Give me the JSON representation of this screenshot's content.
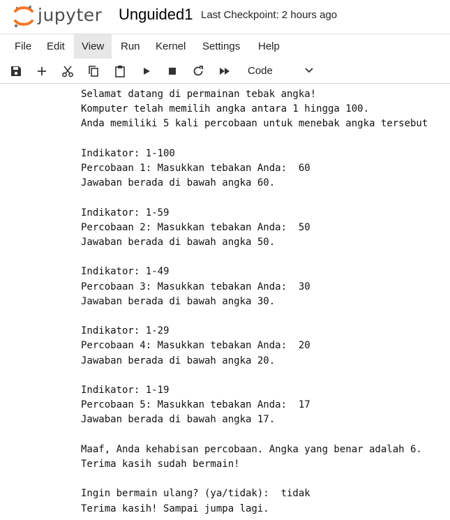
{
  "header": {
    "logo_text": "jupyter",
    "notebook_title": "Unguided1",
    "checkpoint": "Last Checkpoint: 2 hours ago"
  },
  "menu": {
    "items": [
      "File",
      "Edit",
      "View",
      "Run",
      "Kernel",
      "Settings",
      "Help"
    ],
    "active": "View"
  },
  "toolbar": {
    "buttons": [
      "save-icon",
      "add-icon",
      "cut-icon",
      "copy-icon",
      "paste-icon",
      "run-icon",
      "stop-icon",
      "restart-icon",
      "fast-forward-icon"
    ],
    "cell_type": "Code"
  },
  "output": {
    "lines": [
      "Selamat datang di permainan tebak angka!",
      "Komputer telah memilih angka antara 1 hingga 100.",
      "Anda memiliki 5 kali percobaan untuk menebak angka tersebut",
      "",
      "Indikator: 1-100",
      "Percobaan 1: Masukkan tebakan Anda:  60",
      "Jawaban berada di bawah angka 60.",
      "",
      "Indikator: 1-59",
      "Percobaan 2: Masukkan tebakan Anda:  50",
      "Jawaban berada di bawah angka 50.",
      "",
      "Indikator: 1-49",
      "Percobaan 3: Masukkan tebakan Anda:  30",
      "Jawaban berada di bawah angka 30.",
      "",
      "Indikator: 1-29",
      "Percobaan 4: Masukkan tebakan Anda:  20",
      "Jawaban berada di bawah angka 20.",
      "",
      "Indikator: 1-19",
      "Percobaan 5: Masukkan tebakan Anda:  17",
      "Jawaban berada di bawah angka 17.",
      "",
      "Maaf, Anda kehabisan percobaan. Angka yang benar adalah 6.",
      "Terima kasih sudah bermain!",
      "",
      "Ingin bermain ulang? (ya/tidak):  tidak",
      "Terima kasih! Sampai jumpa lagi."
    ]
  },
  "colors": {
    "logo_orange": "#f37626",
    "active_menu_bg": "#e7e7e7",
    "icon": "#333333"
  }
}
